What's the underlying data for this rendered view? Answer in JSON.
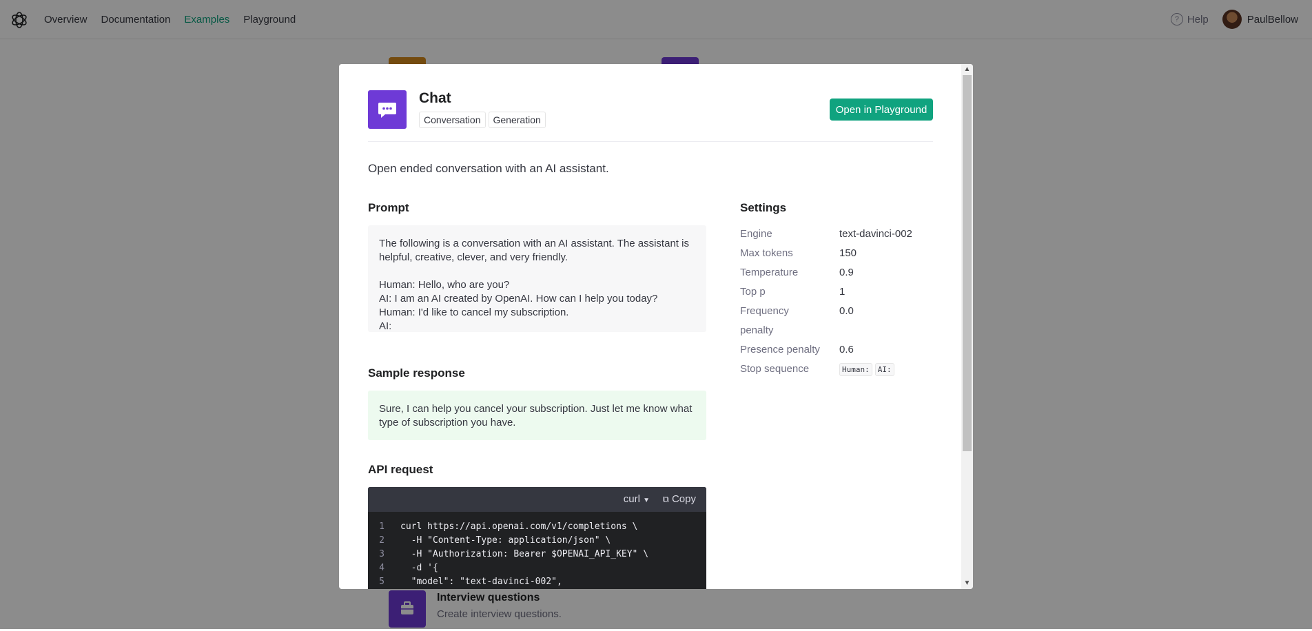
{
  "nav": {
    "links": [
      "Overview",
      "Documentation",
      "Examples",
      "Playground"
    ],
    "active": "Examples",
    "help": "Help",
    "username": "PaulBellow"
  },
  "background_cards": [
    {
      "title": "Interview questions",
      "description": "Create interview questions."
    }
  ],
  "modal": {
    "title": "Chat",
    "tags": [
      "Conversation",
      "Generation"
    ],
    "open_button": "Open in Playground",
    "description": "Open ended conversation with an AI assistant.",
    "prompt_heading": "Prompt",
    "prompt_text": "The following is a conversation with an AI assistant. The assistant is helpful, creative, clever, and very friendly.\n\nHuman: Hello, who are you?\nAI: I am an AI created by OpenAI. How can I help you today?\nHuman: I'd like to cancel my subscription.\nAI:",
    "sample_heading": "Sample response",
    "sample_text": "Sure, I can help you cancel your subscription. Just let me know what type of subscription you have.",
    "api_heading": "API request",
    "code_lang": "curl",
    "copy_label": "Copy",
    "code_lines": [
      {
        "n": "1",
        "text": "curl https://api.openai.com/v1/completions \\"
      },
      {
        "n": "2",
        "text": "  -H \"Content-Type: application/json\" \\"
      },
      {
        "n": "3",
        "text": "  -H \"Authorization: Bearer $OPENAI_API_KEY\" \\"
      },
      {
        "n": "4",
        "text": "  -d '{"
      },
      {
        "n": "5",
        "text": "  \"model\": \"text-davinci-002\","
      }
    ],
    "settings": {
      "heading": "Settings",
      "engine_label": "Engine",
      "engine": "text-davinci-002",
      "max_tokens_label": "Max tokens",
      "max_tokens": "150",
      "temperature_label": "Temperature",
      "temperature": "0.9",
      "top_p_label": "Top p",
      "top_p": "1",
      "frequency_label_1": "Frequency",
      "frequency_label_2": "penalty",
      "frequency": "0.0",
      "presence_label": "Presence penalty",
      "presence": "0.6",
      "stop_label": "Stop sequence",
      "stop_1": "Human:",
      "stop_2": "AI:"
    }
  },
  "colors": {
    "accent": "#10a37f",
    "chat_tile": "#6e3ad6",
    "code_bg": "#202123"
  }
}
